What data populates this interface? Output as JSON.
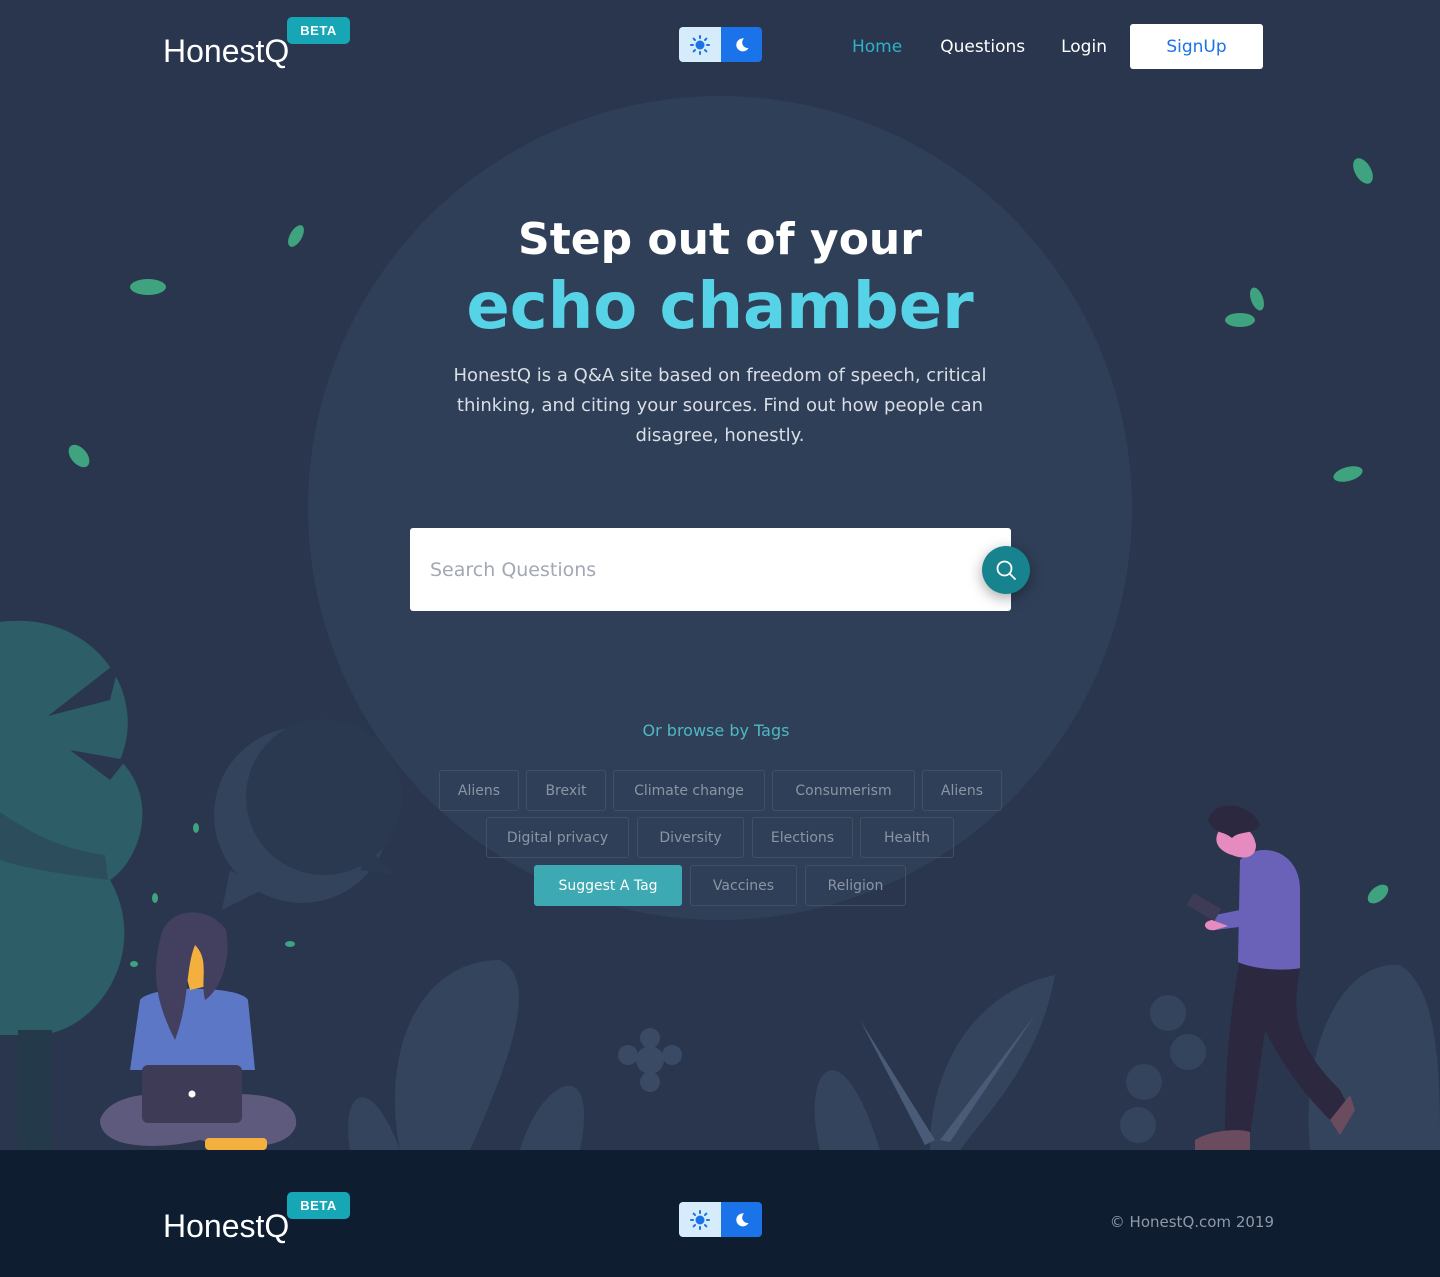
{
  "header": {
    "brand": "HonestQ",
    "beta_badge": "BETA",
    "nav": {
      "home": "Home",
      "questions": "Questions",
      "login": "Login",
      "signup": "SignUp"
    }
  },
  "hero": {
    "headline_line1": "Step out of your",
    "headline_line2": "echo chamber",
    "tagline": "HonestQ is a Q&A site based on freedom of speech, critical thinking, and citing your sources. Find out how people can disagree, honestly."
  },
  "search": {
    "placeholder": "Search Questions"
  },
  "tags": {
    "browse_label": "Or browse by Tags",
    "row1": [
      "Aliens",
      "Brexit",
      "Climate change",
      "Consumerism",
      "Aliens"
    ],
    "row2": [
      "Digital privacy",
      "Diversity",
      "Elections",
      "Health"
    ],
    "suggest_label": "Suggest A Tag",
    "row3": [
      "Vaccines",
      "Religion"
    ]
  },
  "footer": {
    "brand": "HonestQ",
    "beta_badge": "BETA",
    "copyright": "© HonestQ.com 2019"
  },
  "colors": {
    "background": "#29364d",
    "accent_cyan": "#56d3e6",
    "accent_teal": "#3da9b3",
    "primary_blue": "#1a73e8",
    "footer_bg": "#0e1d30"
  },
  "icons": [
    "sun-icon",
    "moon-icon",
    "search-icon"
  ]
}
